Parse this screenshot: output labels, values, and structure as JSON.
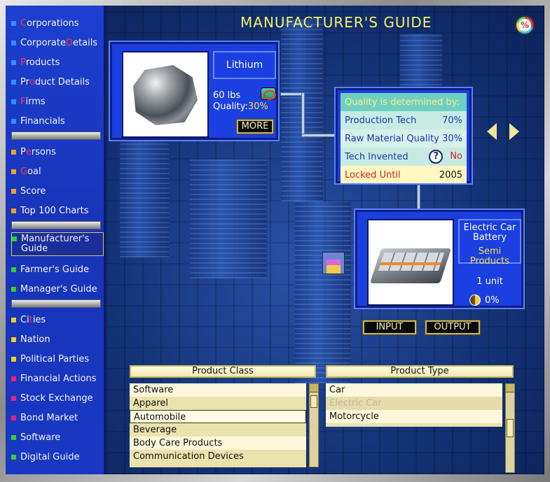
{
  "sidebar": {
    "items": [
      {
        "pre": "",
        "hl": "C",
        "post": "orporations",
        "color": "#2f8fff"
      },
      {
        "pre": "Corporate ",
        "hl": "D",
        "post": "etails",
        "color": "#2f8fff"
      },
      {
        "pre": "",
        "hl": "P",
        "post": "roducts",
        "color": "#2f8fff"
      },
      {
        "pre": "Pr",
        "hl": "o",
        "post": "duct Details",
        "color": "#2f8fff"
      },
      {
        "pre": "",
        "hl": "F",
        "post": "irms",
        "color": "#2f8fff"
      },
      {
        "pre": "Financials",
        "hl": "",
        "post": "",
        "color": "#2f8fff"
      },
      {
        "pre": "P",
        "hl": "e",
        "post": "rsons",
        "color": "#f0a020"
      },
      {
        "pre": "",
        "hl": "G",
        "post": "oal",
        "color": "#f0a020"
      },
      {
        "pre": "Score",
        "hl": "",
        "post": "",
        "color": "#f0a020"
      },
      {
        "pre": "Top 100 Charts",
        "hl": "",
        "post": "",
        "color": "#f0a020"
      },
      {
        "pre": "Manufacturer's Guide",
        "hl": "",
        "post": "",
        "color": "#30d030"
      },
      {
        "pre": "Farmer's Guide",
        "hl": "",
        "post": "",
        "color": "#30d030"
      },
      {
        "pre": "Manager's Guide",
        "hl": "",
        "post": "",
        "color": "#30d030"
      },
      {
        "pre": "Ci",
        "hl": "t",
        "post": "ies",
        "color": "#f0d020"
      },
      {
        "pre": "Nation",
        "hl": "",
        "post": "",
        "color": "#f0d020"
      },
      {
        "pre": "Political Parties",
        "hl": "",
        "post": "",
        "color": "#f0d020"
      },
      {
        "pre": "Financial Actions",
        "hl": "",
        "post": "",
        "color": "#e8208a"
      },
      {
        "pre": "Stock Exchange",
        "hl": "",
        "post": "",
        "color": "#e8208a"
      },
      {
        "pre": "Bond Market",
        "hl": "",
        "post": "",
        "color": "#e8208a"
      },
      {
        "pre": "Software",
        "hl": "",
        "post": "",
        "color": "#30d030"
      },
      {
        "pre": "Digital Guide",
        "hl": "",
        "post": "",
        "color": "#30d030"
      }
    ]
  },
  "header": {
    "title": "MANUFACTURER'S GUIDE",
    "pct_icon": "%"
  },
  "source": {
    "name": "Lithium",
    "quantity": "60 lbs",
    "quality_label": "Quality:",
    "quality_value": "30%",
    "more_label": "MORE"
  },
  "quality_panel": {
    "title": "Quality is determined by:",
    "production_tech_label": "Production Tech",
    "production_tech_value": "70%",
    "raw_material_label": "Raw Material Quality",
    "raw_material_value": "30%",
    "tech_invented_label": "Tech Invented",
    "tech_invented_value": "No",
    "help_icon": "?",
    "locked_label": "Locked Until",
    "locked_value": "2005"
  },
  "product": {
    "name": "Electric Car Battery",
    "class": "Semi Products",
    "unit": "1 unit",
    "yield": "0%"
  },
  "buttons": {
    "input": "INPUT",
    "output": "OUTPUT"
  },
  "product_class": {
    "header": "Product Class",
    "items": [
      "Software",
      "Apparel",
      "Automobile",
      "Beverage",
      "Body Care Products",
      "Communication Devices"
    ],
    "selected": "Automobile"
  },
  "product_type": {
    "header": "Product Type",
    "items": [
      "Car",
      "Electric Car",
      "Motorcycle"
    ],
    "selected": "Electric Car"
  }
}
